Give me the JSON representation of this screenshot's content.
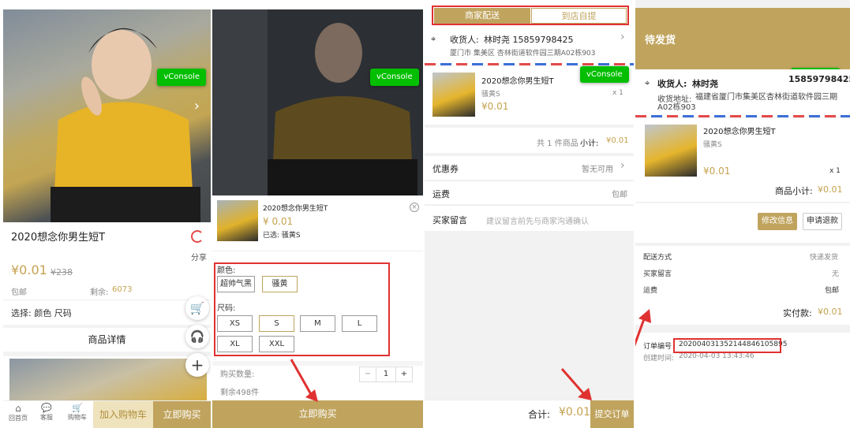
{
  "p1": {
    "product_title": "2020想念你男生短T",
    "share_label": "分享",
    "price": "¥0.01",
    "old_price": "¥238",
    "shipping": "包邮",
    "stock_label": "剩余:",
    "stock_value": "6073",
    "select_label": "选择: 颜色 尺码",
    "details_tab": "商品详情",
    "vconsole": "vConsole",
    "nav": {
      "home": "回首页",
      "service": "客服",
      "cart": "购物车",
      "add_cart": "加入购物车",
      "buy_now": "立即购买"
    }
  },
  "p2": {
    "vconsole": "vConsole",
    "product_name": "2020想念你男生短T",
    "price": "¥ 0.01",
    "selected": "已选: 骚黄S",
    "color_label": "颜色:",
    "colors": [
      "超帅气黑",
      "骚黄"
    ],
    "size_label": "尺码:",
    "sizes_row1": [
      "XS",
      "S",
      "M",
      "L"
    ],
    "sizes_row2": [
      "XL",
      "XXL"
    ],
    "qty_label": "购买数量:",
    "qty_value": "1",
    "qty_minus": "−",
    "qty_plus": "+",
    "stock_remaining": "剩余498件",
    "buy_now": "立即购买"
  },
  "p3": {
    "tab_merchant": "商家配送",
    "tab_pickup": "到店自提",
    "consignee_label": "收货人:",
    "consignee_name": "林时尧 15859798425",
    "address": "厦门市 集美区 杏林街道软件园三期A02栋903",
    "vconsole": "vConsole",
    "product_name": "2020想念你男生短T",
    "variant": "骚黄S",
    "price": "¥0.01",
    "qty": "x 1",
    "summary_count": "共 1 件商品",
    "subtotal_label": "小计:",
    "subtotal_value": "¥0.01",
    "coupon_label": "优惠券",
    "coupon_value": "暂无可用",
    "freight_label": "运费",
    "freight_value": "包邮",
    "message_label": "买家留言",
    "message_placeholder": "建议留言前先与商家沟通确认",
    "total_label": "合计:",
    "total_value": "¥0.01",
    "submit": "提交订单"
  },
  "p4": {
    "status": "待发货",
    "vconsole": "vConsole",
    "consignee_label": "收货人:",
    "consignee_name": "林时尧",
    "phone_partial": "15859798425",
    "address_label": "收货地址:",
    "address": "福建省厦门市集美区杏林街道软件园三期A02栋903",
    "product_name": "2020想念你男生短T",
    "variant": "骚黄S",
    "price": "¥0.01",
    "qty": "x 1",
    "subtotal_label": "商品小计:",
    "subtotal_value": "¥0.01",
    "modify_btn": "修改信息",
    "refund_btn": "申请退款",
    "delivery_label": "配送方式",
    "delivery_value": "快递发货",
    "message_label": "买家留言",
    "message_value": "无",
    "freight_label": "运费",
    "freight_value": "包邮",
    "paid_label": "实付款:",
    "paid_value": "¥0.01",
    "order_no_label": "订单编号",
    "order_no": "2020040313521448461058​95",
    "created_label": "创建时间:",
    "created_value": "2020-04-03 13:43:46"
  }
}
